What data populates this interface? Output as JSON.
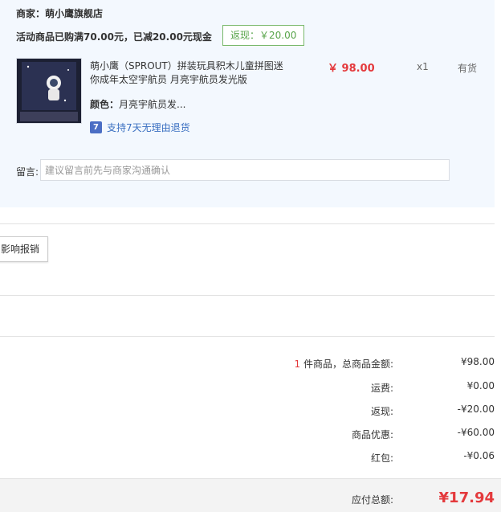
{
  "shop": {
    "label": "商家：萌小鹰旗舰店"
  },
  "promo": {
    "text": "活动商品已购满70.00元，已减20.00元现金",
    "rebate": "返现：￥20.00"
  },
  "product": {
    "thumb_alt": "萌小鹰 宇航员拼图",
    "title": "萌小鹰（SPROUT）拼装玩具积木儿童拼图迷你成年太空宇航员 月亮宇航员发光版",
    "price": "￥ 98.00",
    "qty": "x1",
    "stock": "有货",
    "spec_label": "颜色：",
    "spec_value": "月亮宇航员发...",
    "return_icon": "seven-day-return-icon",
    "return_text": "支持7天无理由退货"
  },
  "memo": {
    "label": "留言:",
    "placeholder": "建议留言前先与商家沟通确认"
  },
  "invoice": {
    "button_label": "影响报销"
  },
  "summary": {
    "count": "1",
    "goods_label": " 件商品，总商品金额:",
    "goods_value": "¥98.00",
    "shipping_label": "运费:",
    "shipping_value": "¥0.00",
    "cashback_label": "返现:",
    "cashback_value": "-¥20.00",
    "discount_label": "商品优惠:",
    "discount_value": "-¥60.00",
    "redpacket_label": "红包:",
    "redpacket_value": "-¥0.06",
    "total_label": "应付总额:",
    "total_value": "¥17.94"
  },
  "colors": {
    "accent_red": "#e4393c",
    "rebate_green": "#58a44a",
    "link_blue": "#3a6fc1",
    "panel_bg": "#f3f8fe"
  }
}
